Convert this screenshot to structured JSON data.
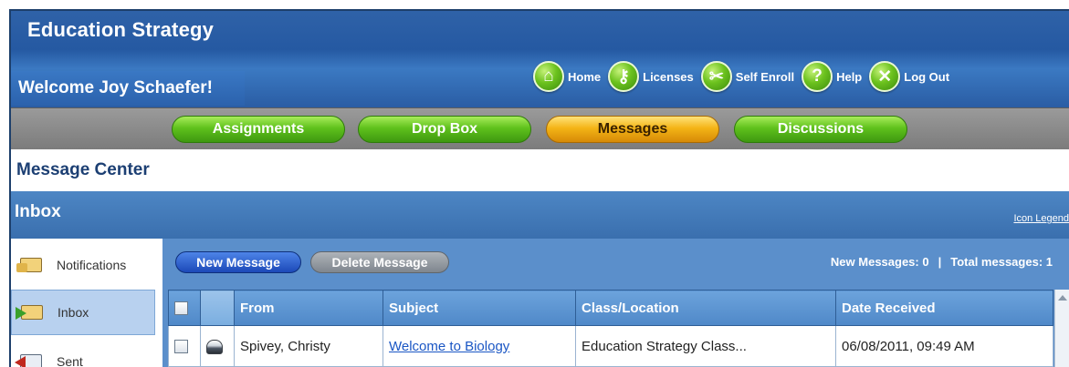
{
  "header": {
    "title": "Education Strategy",
    "welcome": "Welcome Joy Schaefer!"
  },
  "topnav": [
    {
      "label": "Home",
      "icon": "home-icon"
    },
    {
      "label": "Licenses",
      "icon": "key-icon"
    },
    {
      "label": "Self Enroll",
      "icon": "tools-icon"
    },
    {
      "label": "Help",
      "icon": "help-icon"
    },
    {
      "label": "Log Out",
      "icon": "close-icon"
    }
  ],
  "tabs": [
    {
      "label": "Assignments",
      "active": false
    },
    {
      "label": "Drop Box",
      "active": false
    },
    {
      "label": "Messages",
      "active": true
    },
    {
      "label": "Discussions",
      "active": false
    }
  ],
  "message_center": {
    "title": "Message Center"
  },
  "inbox": {
    "title": "Inbox",
    "icon_legend": "Icon Legend"
  },
  "sidebar": {
    "items": [
      {
        "label": "Notifications",
        "icon": "notifications-icon"
      },
      {
        "label": "Inbox",
        "icon": "inbox-icon",
        "active": true
      },
      {
        "label": "Sent",
        "icon": "sent-icon"
      }
    ]
  },
  "toolbar": {
    "new_message": "New Message",
    "delete_message": "Delete Message",
    "new_messages_label": "New Messages: 0",
    "total_messages_label": "Total messages: 1",
    "separator": "|"
  },
  "table": {
    "headers": [
      "From",
      "Subject",
      "Class/Location",
      "Date Received"
    ],
    "rows": [
      {
        "from": "Spivey, Christy",
        "subject": "Welcome to Biology",
        "class_location": "Education Strategy Class...",
        "date": "06/08/2011, 09:49 AM"
      }
    ]
  },
  "colors": {
    "header_blue": "#2f62a8",
    "tab_green": "#5fc11c",
    "tab_active": "#f4b416",
    "text_navy": "#1c3f73"
  }
}
